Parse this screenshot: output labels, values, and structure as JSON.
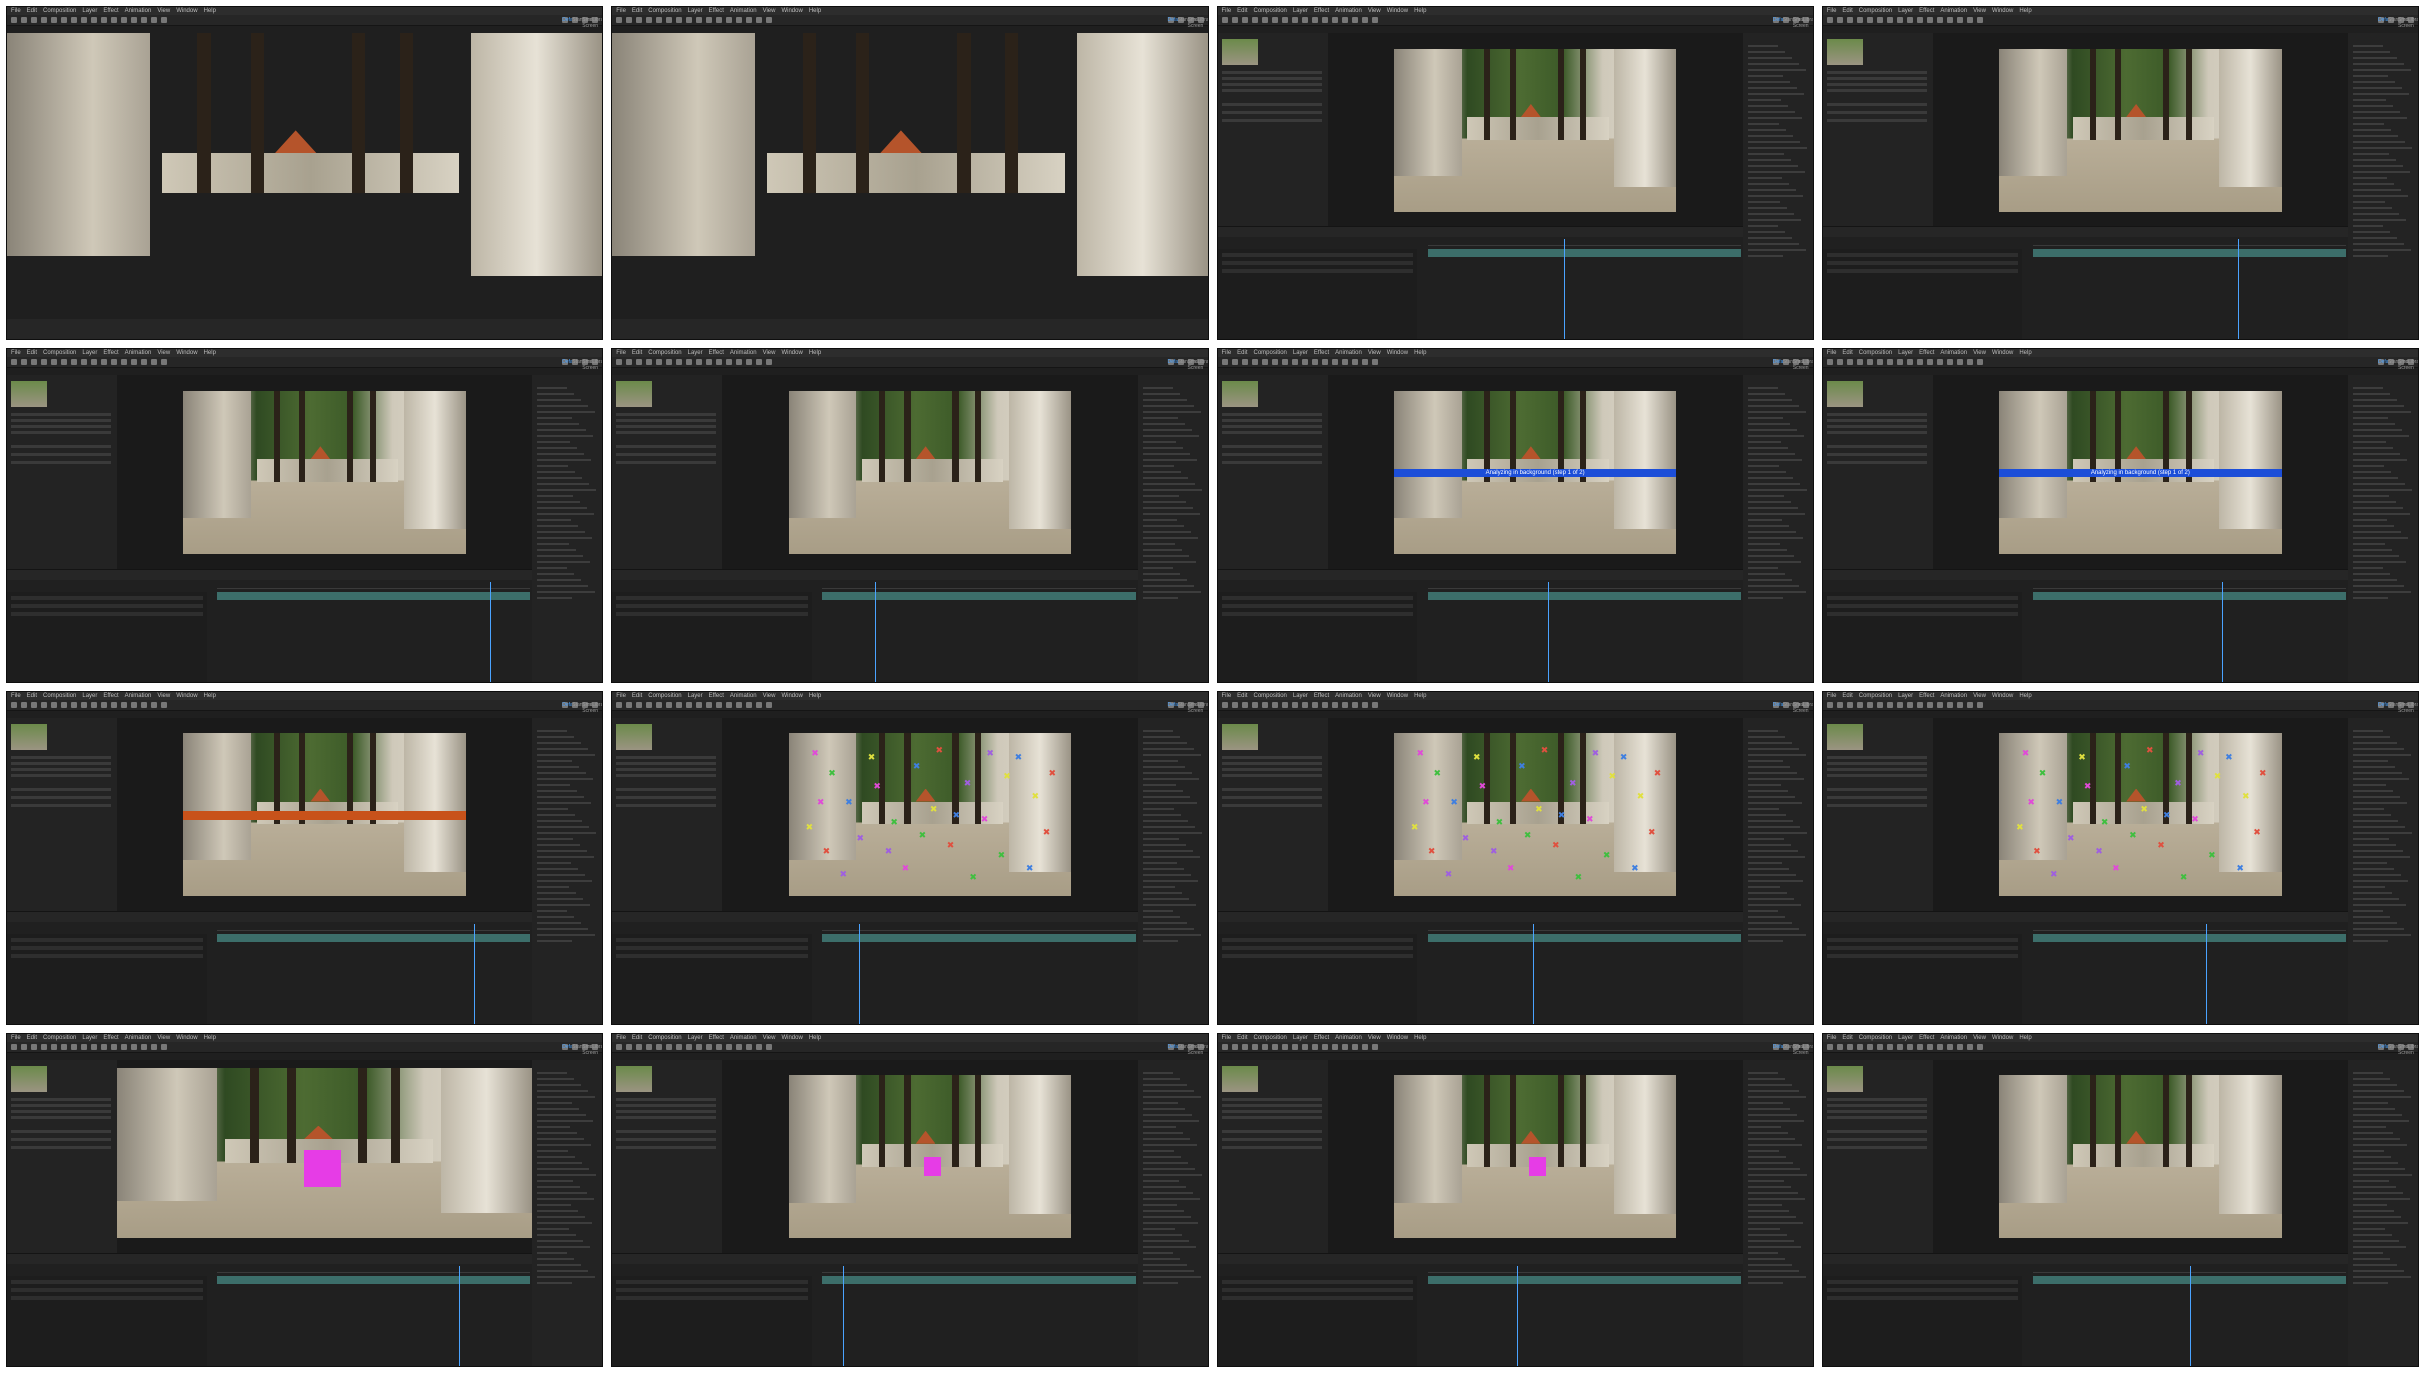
{
  "menu": [
    "File",
    "Edit",
    "Composition",
    "Layer",
    "Effect",
    "Animation",
    "View",
    "Window",
    "Help"
  ],
  "workspace": {
    "active": "Default",
    "others": [
      "Standard",
      "Small Screen",
      "Libraries"
    ]
  },
  "banners": {
    "analyzing": "Analyzing in background (step 1 of 2)"
  },
  "colors": {
    "accent": "#4aa3ff",
    "analyze_bar": "#1c4ed8",
    "solve_bar": "#c8521a",
    "solid": "#e63ce6",
    "track_bar": "#3c6e6a"
  },
  "tiles": [
    {
      "layout": "fullscreen",
      "overlay": "none"
    },
    {
      "layout": "fullscreen",
      "overlay": "none"
    },
    {
      "layout": "editor",
      "overlay": "none"
    },
    {
      "layout": "editor",
      "overlay": "none"
    },
    {
      "layout": "editor",
      "overlay": "none"
    },
    {
      "layout": "editor",
      "overlay": "none"
    },
    {
      "layout": "editor",
      "overlay": "analyze"
    },
    {
      "layout": "editor",
      "overlay": "analyze"
    },
    {
      "layout": "editor",
      "overlay": "solve"
    },
    {
      "layout": "editor",
      "overlay": "trackpoints"
    },
    {
      "layout": "editor",
      "overlay": "trackpoints"
    },
    {
      "layout": "editor",
      "overlay": "trackpoints"
    },
    {
      "layout": "editor",
      "overlay": "solid"
    },
    {
      "layout": "editor",
      "overlay": "solid"
    },
    {
      "layout": "editor",
      "overlay": "solid"
    },
    {
      "layout": "editor",
      "overlay": "none"
    }
  ]
}
